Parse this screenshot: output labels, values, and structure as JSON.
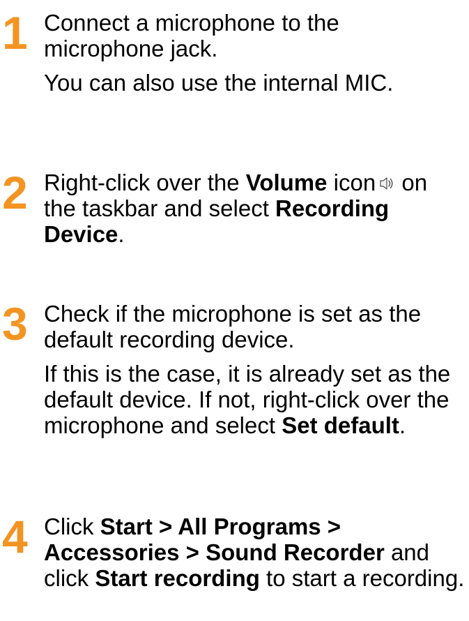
{
  "steps": [
    {
      "number": "1",
      "paragraphs": [
        {
          "pre": "Connect a microphone to the microphone jack."
        },
        {
          "pre": "You can also use the internal MIC."
        }
      ]
    },
    {
      "number": "2",
      "p1": {
        "pre": "Right-click over the ",
        "b1": "Volume",
        "mid": " icon",
        "icon": "speaker-volume-icon",
        "post": " on the taskbar and select ",
        "b2": "Recording Device",
        "end": "."
      }
    },
    {
      "number": "3",
      "p1": {
        "pre": "Check if the microphone is set as the default recording device."
      },
      "p2": {
        "pre": "If this is the case, it is already set as the default device. If not, right-click over the microphone and select ",
        "b1": "Set default",
        "end": "."
      }
    },
    {
      "number": "4",
      "p1": {
        "pre": "Click ",
        "b1": "Start > All Programs > Accessories > Sound Recorder",
        "mid": " and click ",
        "b2": "Start recording",
        "end": " to start a recording."
      }
    }
  ],
  "colors": {
    "step_number": "#f39422",
    "text": "#000000"
  }
}
